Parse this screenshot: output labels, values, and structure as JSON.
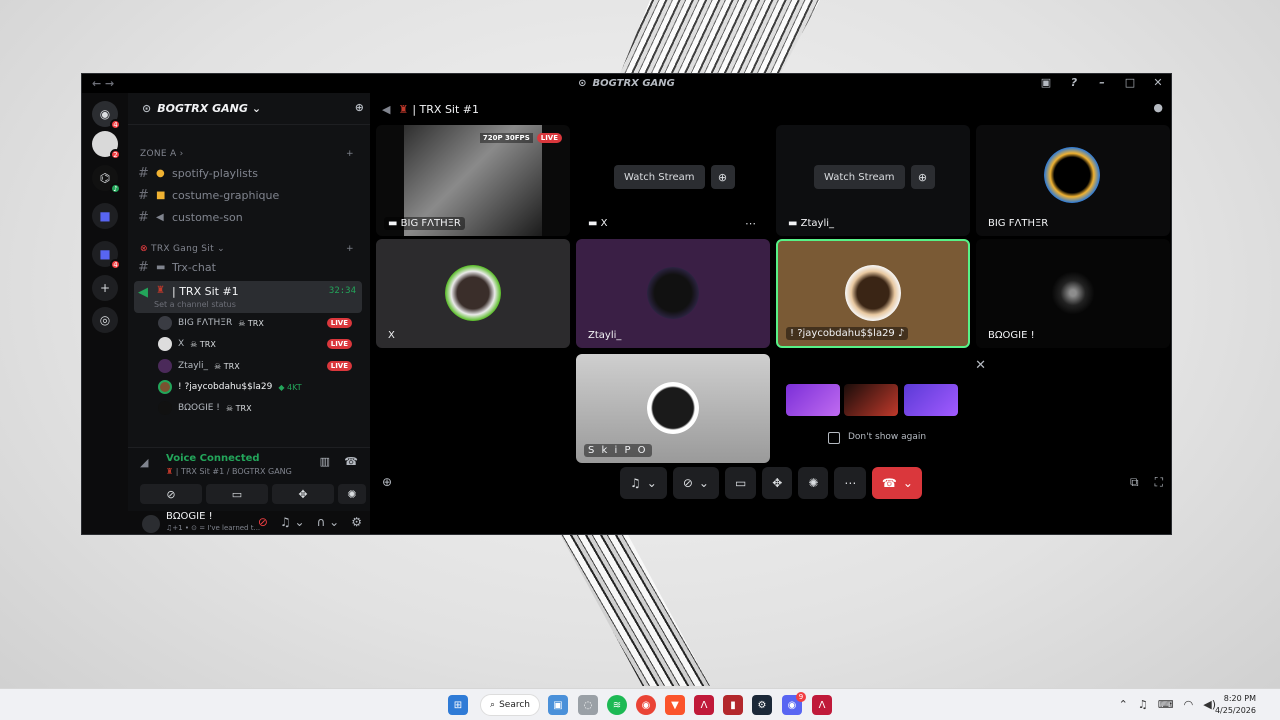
{
  "window": {
    "title": "BOGTRX GANG"
  },
  "server": {
    "name": "BOGTRX GANG"
  },
  "channels": {
    "zone_label": "ZONE A",
    "zone_items": [
      {
        "name": "spotify-playlists"
      },
      {
        "name": "costume-graphique"
      },
      {
        "name": "custome-son"
      }
    ],
    "category": "TRX Gang Sit",
    "chat": "Trx-chat",
    "active": {
      "name": "| TRX Sit #1",
      "timer": "32:34",
      "status": "Set a channel status"
    },
    "voice_users": [
      {
        "name": "BIG FΛTHΞR",
        "tag": "TRX",
        "live": "LIVE"
      },
      {
        "name": "X",
        "tag": "TRX",
        "live": "LIVE"
      },
      {
        "name": "Ztayli_",
        "tag": "TRX",
        "live": "LIVE"
      },
      {
        "name": "! ?jaycobdahu$$la29",
        "tag": "4KT",
        "live": ""
      },
      {
        "name": "BΩOGIE !",
        "tag": "TRX",
        "live": ""
      }
    ]
  },
  "voice": {
    "status": "Voice Connected",
    "channel": "| TRX Sit #1 / BOGTRX GANG"
  },
  "user": {
    "name": "BΩOGIE !",
    "status": "♫+1 • ⊙ = I've learned t..."
  },
  "stage": {
    "header": "| TRX Sit #1",
    "stream_quality": "720P 30FPS",
    "live": "LIVE",
    "watch_label": "Watch Stream",
    "tiles": [
      {
        "label": "BIG FΛTHΞR"
      },
      {
        "label": "X"
      },
      {
        "label": "Ztayli_"
      },
      {
        "label": "BIG FΛTHΞR"
      },
      {
        "label": "X"
      },
      {
        "label": "Ztayli_"
      },
      {
        "label": "! ?jaycobdahu$$la29"
      },
      {
        "label": "BΩOGIE !"
      },
      {
        "label": "S k i P O"
      }
    ]
  },
  "promo": {
    "dont_show": "Don't show again",
    "brand_colors": [
      "#7b2fd8",
      "#c0392b",
      "#5b3ad6"
    ]
  },
  "taskbar": {
    "search": "Search",
    "time": "8:20 PM",
    "date": "4/25/2026",
    "discord_badge": "9"
  },
  "colors": {
    "accent_green": "#23a55a",
    "danger": "#da373c",
    "speaking_border": "#57f287"
  }
}
